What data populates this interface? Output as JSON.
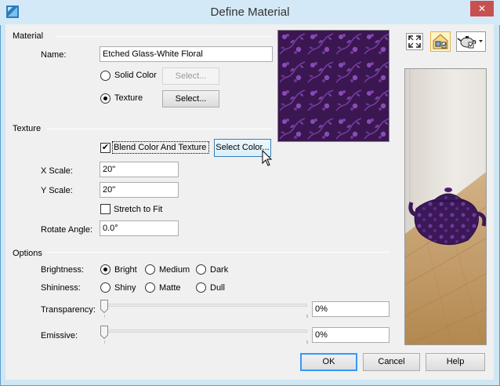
{
  "window": {
    "title": "Define Material",
    "close_glyph": "✕"
  },
  "material": {
    "group_label": "Material",
    "name_label": "Name:",
    "name_value": "Etched Glass-White Floral",
    "solid_color_label": "Solid Color",
    "solid_color_button": "Select...",
    "texture_label": "Texture",
    "texture_button": "Select...",
    "selected_mode": "Texture"
  },
  "texture": {
    "group_label": "Texture",
    "blend_label": "Blend Color And Texture",
    "blend_checked": true,
    "select_color_button": "Select Color...",
    "x_scale_label": "X Scale:",
    "x_scale_value": "20\"",
    "y_scale_label": "Y Scale:",
    "y_scale_value": "20\"",
    "stretch_label": "Stretch to Fit",
    "stretch_checked": false,
    "rotate_label": "Rotate Angle:",
    "rotate_value": "0.0°"
  },
  "options": {
    "group_label": "Options",
    "brightness_label": "Brightness:",
    "brightness_options": [
      "Bright",
      "Medium",
      "Dark"
    ],
    "brightness_selected": "Bright",
    "shininess_label": "Shininess:",
    "shininess_options": [
      "Shiny",
      "Matte",
      "Dull"
    ],
    "shininess_selected": "",
    "transparency_label": "Transparency:",
    "transparency_value": "0%",
    "transparency_level": 0,
    "emissive_label": "Emissive:",
    "emissive_value": "0%",
    "emissive_level": 0
  },
  "buttons": {
    "ok": "OK",
    "cancel": "Cancel",
    "help": "Help"
  },
  "toolbar": {
    "icons": [
      "fullscreen-icon",
      "house-view-icon",
      "teapot-view-icon"
    ]
  },
  "colors": {
    "texture_base": "#3a1750",
    "texture_pattern": "#7a3fa6",
    "floor": "#c8a16a",
    "wall": "#ebe7e2"
  }
}
